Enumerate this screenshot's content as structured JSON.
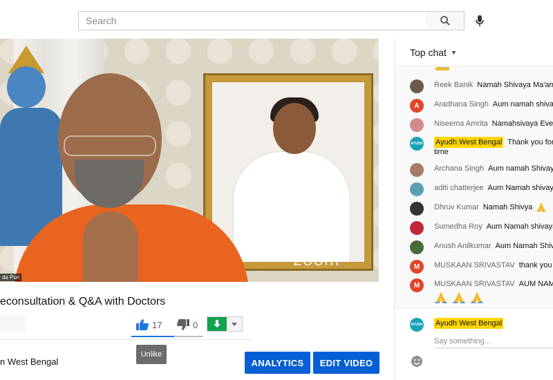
{
  "search": {
    "placeholder": "Search"
  },
  "video": {
    "name_tag": "da Puri",
    "watermark": "zoom",
    "title": "econsultation & Q&A with Doctors"
  },
  "actions": {
    "like_count": "17",
    "dislike_count": "0",
    "tooltip": "Unlike",
    "like_ratio": 0.6
  },
  "channel": {
    "name": "n West Bengal"
  },
  "buttons": {
    "analytics": "ANALYTICS",
    "edit_video": "EDIT VIDEO"
  },
  "chat": {
    "header": "Top chat",
    "messages": [
      {
        "author": "Reek Banik",
        "text": "Namah Shivaya Ma'am",
        "avatar_color": "#6b5a4a",
        "avatar_letter": ""
      },
      {
        "author": "Aradhana Singh",
        "text": "Aum namah shivaya",
        "avatar_color": "#e0462b",
        "avatar_letter": "A"
      },
      {
        "author": "Niseema Amrita",
        "text": "Namahsivaya Everyone",
        "avatar_color": "#d48a8a",
        "avatar_letter": ""
      },
      {
        "author": "Ayudh West Bengal",
        "text": "Thank you for",
        "avatar_color": "#1aa2b8",
        "avatar_letter": "AYUDH",
        "highlight": true
      },
      {
        "author": "Archana Singh",
        "text": "Aum namah Shivaya",
        "avatar_color": "#a87a6a",
        "avatar_letter": ""
      },
      {
        "author": "aditi chatterjee",
        "text": "Aum Namah shivaya",
        "avatar_color": "#5aa0b0",
        "avatar_letter": ""
      },
      {
        "author": "Dhruv Kumar",
        "text": "Namah Shivya",
        "avatar_color": "#333333",
        "avatar_letter": ""
      },
      {
        "author": "Sumedha Roy",
        "text": "Aum Namah shivaya",
        "avatar_color": "#c0283c",
        "avatar_letter": ""
      },
      {
        "author": "Anush Anilkumar",
        "text": "Aum Namah Shivaya",
        "avatar_color": "#4a6a3a",
        "avatar_letter": ""
      },
      {
        "author": "MUSKAAN SRIVASTAV",
        "text": "thank you",
        "avatar_color": "#e0462b",
        "avatar_letter": "M"
      },
      {
        "author": "MUSKAAN SRIVASTAV",
        "text": "AUM NAMAH",
        "avatar_color": "#e0462b",
        "avatar_letter": "M"
      }
    ],
    "wrap_text": "time",
    "input": {
      "author": "Ayudh West Bengal",
      "avatar_letter": "AYUDH",
      "avatar_color": "#1aa2b8",
      "placeholder": "Say something..."
    }
  },
  "icons": {
    "search": "search-icon",
    "mic": "mic-icon",
    "like": "thumbs-up-icon",
    "dislike": "thumbs-down-icon",
    "download": "download-icon",
    "dropdown": "chevron-down-icon",
    "emoji": "emoji-icon"
  }
}
